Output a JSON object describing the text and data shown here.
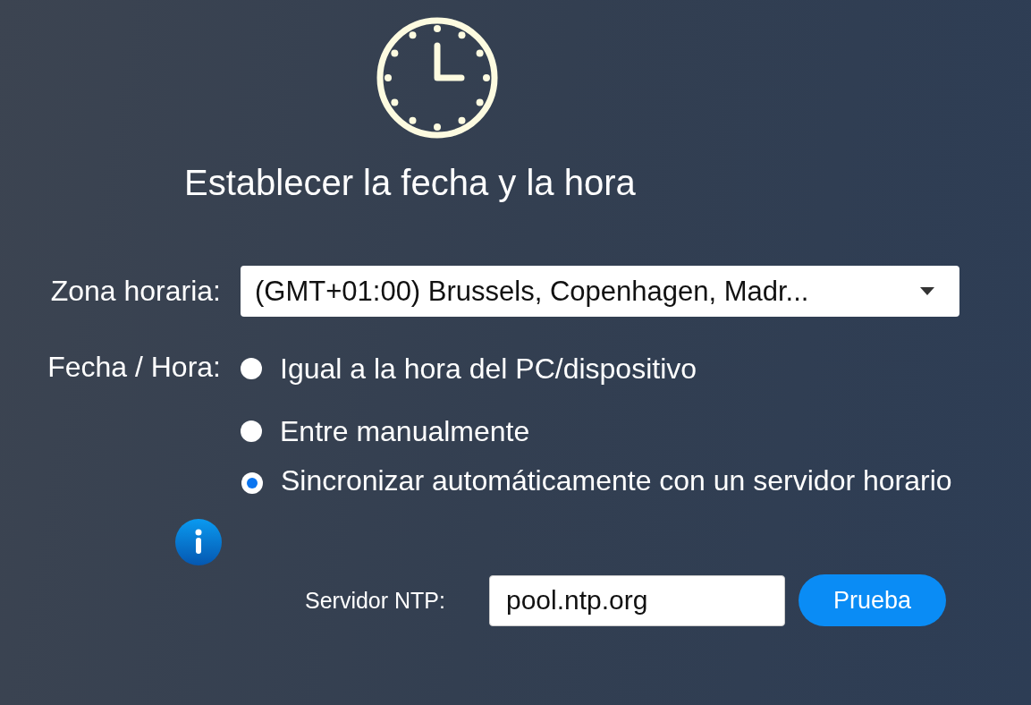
{
  "title": "Establecer la fecha y la hora",
  "timezone": {
    "label": "Zona horaria:",
    "value": "(GMT+01:00) Brussels, Copenhagen, Madr..."
  },
  "datetime": {
    "label": "Fecha / Hora:",
    "options": [
      {
        "label": "Igual a la hora del PC/dispositivo",
        "selected": false
      },
      {
        "label": "Entre manualmente",
        "selected": false
      },
      {
        "label": "Sincronizar automáticamente con un servidor horario",
        "selected": true
      }
    ]
  },
  "ntp": {
    "label": "Servidor NTP:",
    "value": "pool.ntp.org",
    "button": "Prueba"
  }
}
